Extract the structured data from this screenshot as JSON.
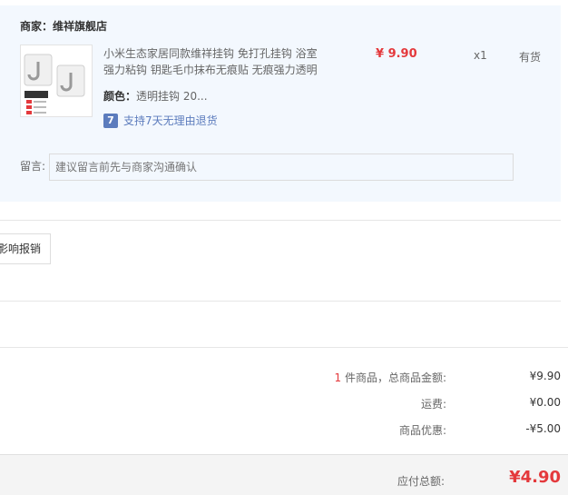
{
  "shop": {
    "label": "商家：维祥旗舰店"
  },
  "product": {
    "thumbnail_icon": "hook-product-image",
    "title_line1": "小米生态家居同款维祥挂钩 免打孔挂钩 浴室",
    "title_line2": "强力粘钩 钥匙毛巾抹布无痕贴 无痕强力透明",
    "price": "¥ 9.90",
    "quantity": "x1",
    "stock": "有货",
    "attr_label": "颜色：",
    "attr_value": "透明挂钩 20...",
    "service_icon": "7",
    "service_text": "支持7天无理由退货"
  },
  "memo": {
    "label": "留言:",
    "placeholder": "建议留言前先与商家沟通确认"
  },
  "invoice_button": "影响报销",
  "summary": {
    "count": "1",
    "items_label": " 件商品，总商品金额:",
    "items_value": "¥9.90",
    "shipping_label": "运费:",
    "shipping_value": "¥0.00",
    "discount_label": "商品优惠:",
    "discount_value": "-¥5.00",
    "total_label": "应付总额:",
    "total_value": "¥4.90"
  },
  "colors": {
    "accent": "#e4393c",
    "panel": "#f3f8fe",
    "service": "#5c7cbd"
  }
}
